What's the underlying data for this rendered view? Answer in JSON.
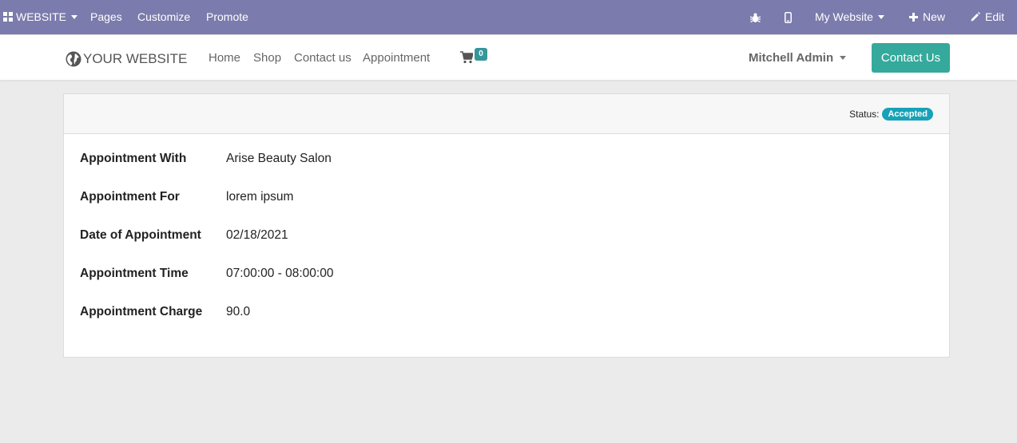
{
  "adminbar": {
    "website_label": "WEBSITE",
    "pages": "Pages",
    "customize": "Customize",
    "promote": "Promote",
    "my_website": "My Website",
    "new": "New",
    "edit": "Edit"
  },
  "header": {
    "logo_text": "YOUR WEBSITE",
    "nav": [
      "Home",
      "Shop",
      "Contact us",
      "Appointment"
    ],
    "cart_count": "0",
    "user": "Mitchell Admin",
    "contact_button": "Contact Us"
  },
  "appointment": {
    "status_label": "Status:",
    "status_value": "Accepted",
    "fields": [
      {
        "label": "Appointment With",
        "value": "Arise Beauty Salon"
      },
      {
        "label": "Appointment For",
        "value": "lorem ipsum"
      },
      {
        "label": "Date of Appointment",
        "value": "02/18/2021"
      },
      {
        "label": "Appointment Time",
        "value": "07:00:00 - 08:00:00"
      },
      {
        "label": "Appointment Charge",
        "value": "90.0"
      }
    ]
  },
  "colors": {
    "adminbar": "#7c7bad",
    "accent": "#35a99c",
    "status_badge": "#17a2b8"
  },
  "icons": [
    "grid-icon",
    "bug-icon",
    "mobile-icon",
    "plus-icon",
    "pencil-icon",
    "globe-icon",
    "cart-icon",
    "chevron-down-icon"
  ]
}
